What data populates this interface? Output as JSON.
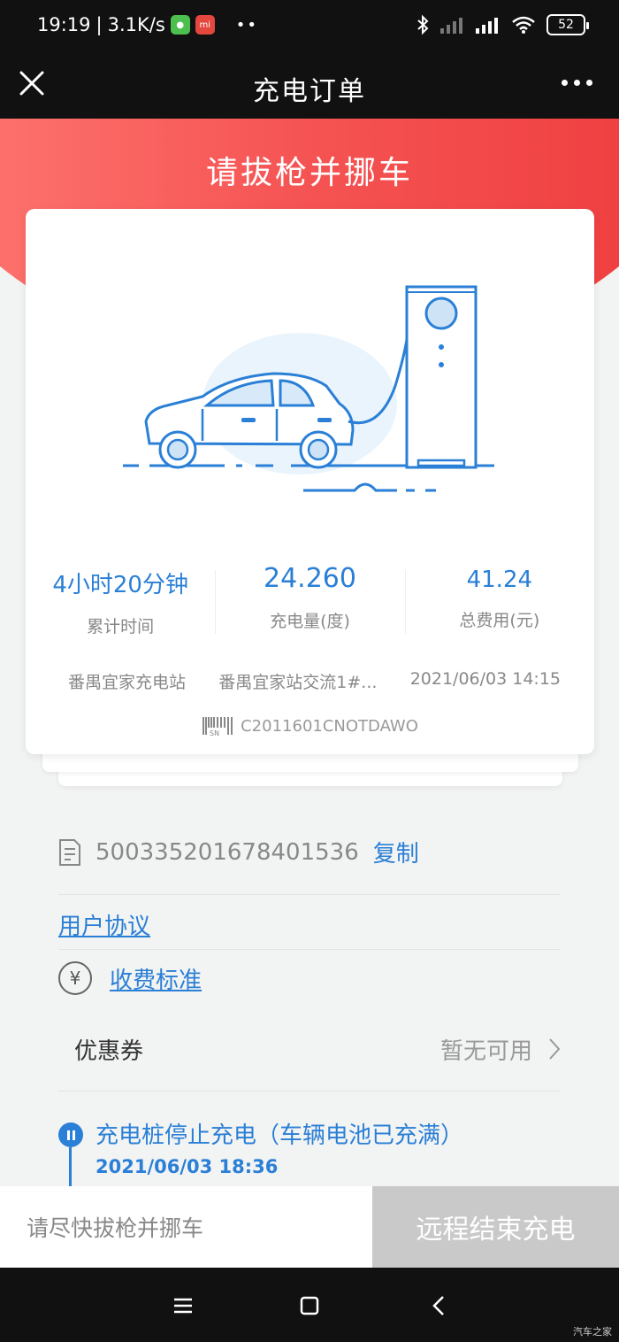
{
  "status_bar": {
    "time": "19:19",
    "speed": "3.1K/s",
    "dots": "••",
    "battery": "52"
  },
  "nav": {
    "title": "充电订单"
  },
  "banner": {
    "title": "请拔枪并挪车"
  },
  "stats": [
    {
      "value": "4小时20分钟",
      "label": "累计时间"
    },
    {
      "value": "24.260",
      "label": "充电量(度)"
    },
    {
      "value": "41.24",
      "label": "总费用(元)"
    }
  ],
  "meta": {
    "station": "番禺宜家充电站",
    "pile": "番禺宜家站交流1#...",
    "datetime": "2021/06/03 14:15"
  },
  "sn": {
    "code": "C2011601CNOTDAWO"
  },
  "order": {
    "number": "500335201678401536",
    "copy_label": "复制"
  },
  "links": {
    "agreement": "用户协议",
    "fee_standard": "收费标准"
  },
  "coupon": {
    "label": "优惠券",
    "value": "暂无可用"
  },
  "timeline": {
    "event": "充电桩停止充电（车辆电池已充满）",
    "time": "2021/06/03 18:36"
  },
  "bottom": {
    "hint": "请尽快拔枪并挪车",
    "action": "远程结束充电"
  },
  "watermark": "汽车之家",
  "colors": {
    "accent_blue": "#2a7fd6",
    "banner_red": "#f55353",
    "disabled_gray": "#c9c9c9"
  }
}
